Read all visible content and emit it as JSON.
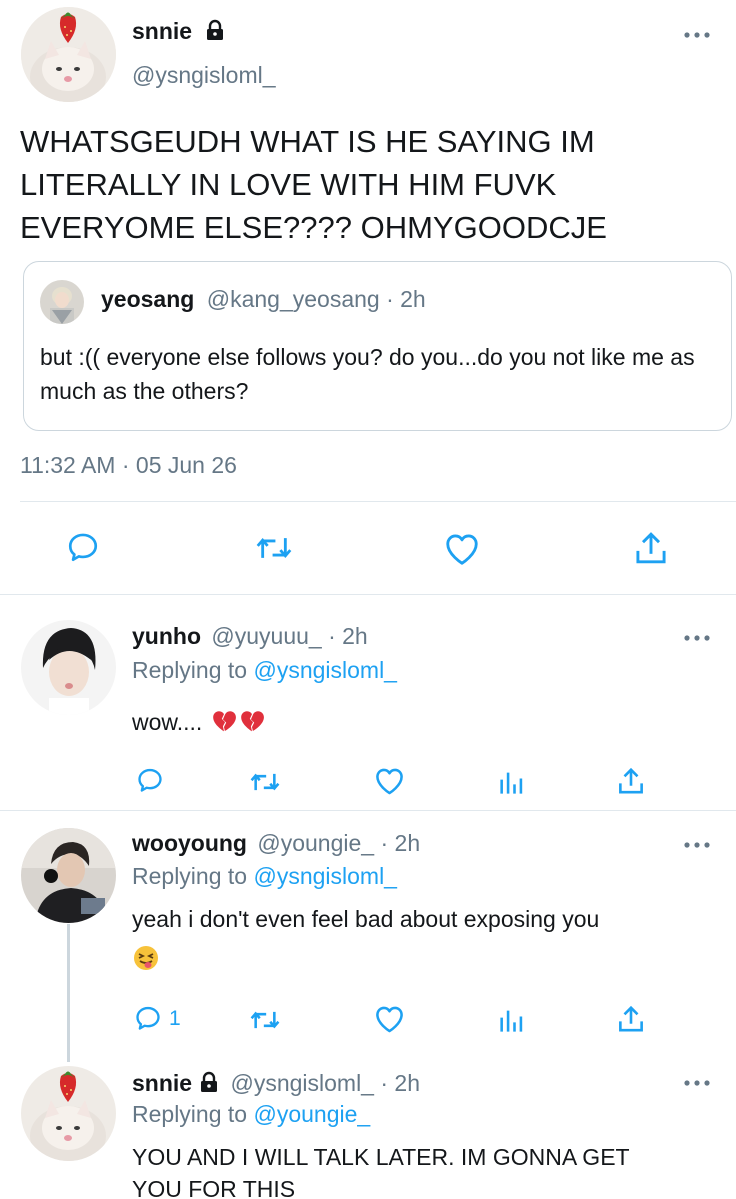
{
  "main_tweet": {
    "display_name": "snnie",
    "handle": "@ysngisloml_",
    "text": "WHATSGEUDH WHAT IS HE SAYING IM LITERALLY IN LOVE WITH HIM FUVK EVERYOME ELSE???? OHMYGOODCJE",
    "quoted": {
      "display_name": "yeosang",
      "handle_time": "@kang_yeosang · 2h",
      "text": "but :(( everyone else follows you? do you...do you not like me as much as the others?"
    },
    "timestamp": "11:32 AM · 05 Jun 26"
  },
  "replies": [
    {
      "display_name": "yunho",
      "handle_time": "@yuyuuu_ · 2h",
      "replying_prefix": "Replying to ",
      "replying_to": "@ysngisloml_",
      "text": "wow....",
      "reply_count": ""
    },
    {
      "display_name": "wooyoung",
      "handle_time": "@youngie_ · 2h",
      "replying_prefix": "Replying to ",
      "replying_to": "@ysngisloml_",
      "text": "yeah i don't even feel bad about exposing you",
      "reply_count": "1"
    },
    {
      "display_name": "snnie",
      "handle_time": "@ysngisloml_ · 2h",
      "replying_prefix": "Replying to ",
      "replying_to": "@youngie_",
      "text_line1": "YOU AND I WILL TALK LATER. IM GONNA GET",
      "text_line2": "YOU FOR THIS"
    }
  ],
  "icons": {
    "more": "more-options-icon",
    "lock": "lock-icon",
    "reply": "reply-icon",
    "retweet": "retweet-icon",
    "like": "like-icon",
    "share": "share-icon",
    "analytics": "analytics-icon"
  },
  "colors": {
    "accent": "#1da1f2",
    "secondary_text": "#657786",
    "divider": "#e1e8ed"
  }
}
